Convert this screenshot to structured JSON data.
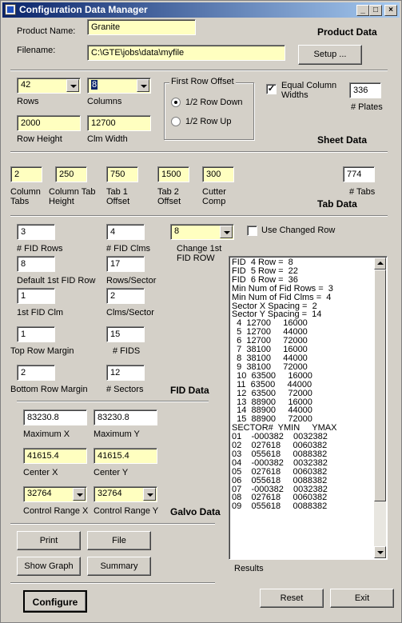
{
  "window": {
    "title": "Configuration Data Manager",
    "min": "_",
    "max": "□",
    "close": "×"
  },
  "product": {
    "name_label": "Product Name:",
    "name_value": "Granite",
    "filename_label": "Filename:",
    "filename_value": "C:\\GTE\\jobs\\data\\myfile",
    "setup_button": "Setup ...",
    "section_title": "Product Data"
  },
  "sheet": {
    "rows_value": "42",
    "rows_label": "Rows",
    "columns_value": "8",
    "columns_label": "Columns",
    "offset_group": "First Row Offset",
    "offset_down": "1/2 Row Down",
    "offset_up": "1/2 Row Up",
    "offset_selected": "down",
    "equal_widths_label": "Equal Column Widths",
    "equal_widths_checked": true,
    "plates_value": "336",
    "plates_label": "# Plates",
    "row_height_value": "2000",
    "row_height_label": "Row Height",
    "clm_width_value": "12700",
    "clm_width_label": "Clm Width",
    "section_title": "Sheet Data"
  },
  "tab": {
    "column_tabs_value": "2",
    "column_tabs_label_1": "Column",
    "column_tabs_label_2": "Tabs",
    "col_tab_height_value": "250",
    "col_tab_height_label_1": "Column Tab",
    "col_tab_height_label_2": "Height",
    "tab1_offset_value": "750",
    "tab1_offset_label_1": "Tab 1",
    "tab1_offset_label_2": "Offset",
    "tab2_offset_value": "1500",
    "tab2_offset_label_1": "Tab 2",
    "tab2_offset_label_2": "Offset",
    "cutter_comp_value": "300",
    "cutter_comp_label_1": "Cutter",
    "cutter_comp_label_2": "Comp",
    "tabs_value": "774",
    "tabs_label": "# Tabs",
    "section_title": "Tab Data"
  },
  "fid": {
    "fid_rows_value": "3",
    "fid_rows_label": "# FID Rows",
    "fid_clms_value": "4",
    "fid_clms_label": "# FID Clms",
    "change_first_value": "8",
    "change_first_label_1": "Change 1st",
    "change_first_label_2": "FID ROW",
    "use_changed_label": "Use Changed Row",
    "use_changed_checked": false,
    "default_first_row_value": "8",
    "default_first_row_label": "Default 1st FID Row",
    "rows_per_sector_value": "17",
    "rows_per_sector_label": "Rows/Sector",
    "first_fid_clm_value": "1",
    "first_fid_clm_label": "1st FID Clm",
    "clms_per_sector_value": "2",
    "clms_per_sector_label": "Clms/Sector",
    "top_row_margin_value": "1",
    "top_row_margin_label": "Top Row Margin",
    "fids_value": "15",
    "fids_label": "# FIDS",
    "bottom_row_margin_value": "2",
    "bottom_row_margin_label": "Bottom Row Margin",
    "sectors_value": "12",
    "sectors_label": "# Sectors",
    "section_title": "FID Data"
  },
  "galvo": {
    "max_x_value": "83230.8",
    "max_x_label": "Maximum X",
    "max_y_value": "83230.8",
    "max_y_label": "Maximum Y",
    "center_x_value": "41615.4",
    "center_x_label": "Center X",
    "center_y_value": "41615.4",
    "center_y_label": "Center Y",
    "range_x_value": "32764",
    "range_x_label": "Control Range X",
    "range_y_value": "32764",
    "range_y_label": "Control Range Y",
    "section_title": "Galvo Data"
  },
  "buttons": {
    "print": "Print",
    "file": "File",
    "show_graph": "Show Graph",
    "summary": "Summary",
    "configure": "Configure",
    "reset": "Reset",
    "exit": "Exit"
  },
  "results": {
    "label": "Results",
    "lines": [
      "FID  4 Row =  8",
      "FID  5 Row =  22",
      "FID  6 Row =  36",
      "Min Num of Fid Rows =  3",
      "Min Num of Fid Clms =  4",
      "Sector X Spacing =  2",
      "Sector Y Spacing =  14",
      "  4  12700     16000",
      "  5  12700     44000",
      "  6  12700     72000",
      "  7  38100     16000",
      "  8  38100     44000",
      "  9  38100     72000",
      "  10  63500     16000",
      "  11  63500     44000",
      "  12  63500     72000",
      "  13  88900     16000",
      "  14  88900     44000",
      "  15  88900     72000",
      "SECTOR#  YMIN     YMAX",
      "01    -000382    0032382",
      "02    027618     0060382",
      "03    055618     0088382",
      "04    -000382    0032382",
      "05    027618     0060382",
      "06    055618     0088382",
      "07    -000382    0032382",
      "08    027618     0060382",
      "09    055618     0088382"
    ]
  }
}
